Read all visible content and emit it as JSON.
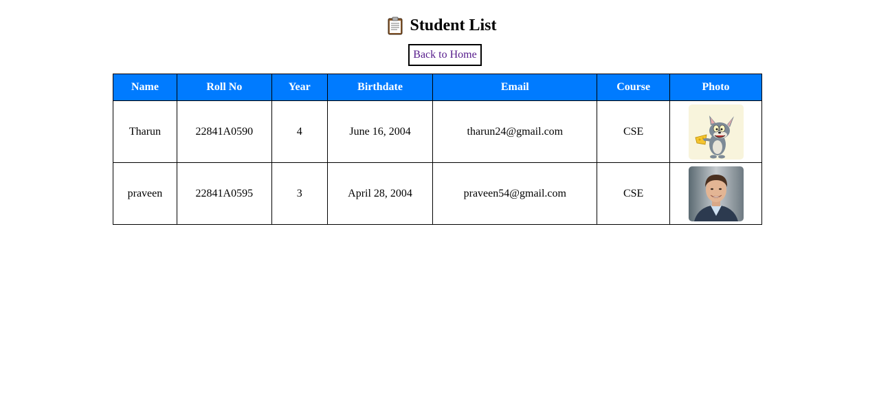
{
  "page": {
    "title": "Student List",
    "title_icon": "clipboard-icon",
    "back_link": "Back to Home"
  },
  "table": {
    "headers": [
      "Name",
      "Roll No",
      "Year",
      "Birthdate",
      "Email",
      "Course",
      "Photo"
    ],
    "rows": [
      {
        "name": "Tharun",
        "roll_no": "22841A0590",
        "year": "4",
        "birthdate": "June 16, 2004",
        "email": "tharun24@gmail.com",
        "course": "CSE",
        "photo": "cartoon-cat-with-cheese-photo"
      },
      {
        "name": "praveen",
        "roll_no": "22841A0595",
        "year": "3",
        "birthdate": "April 28, 2004",
        "email": "praveen54@gmail.com",
        "course": "CSE",
        "photo": "smiling-man-in-suit-photo"
      }
    ]
  },
  "colors": {
    "header_bg": "#007bff",
    "header_text": "#ffffff",
    "link": "#551a8b"
  }
}
